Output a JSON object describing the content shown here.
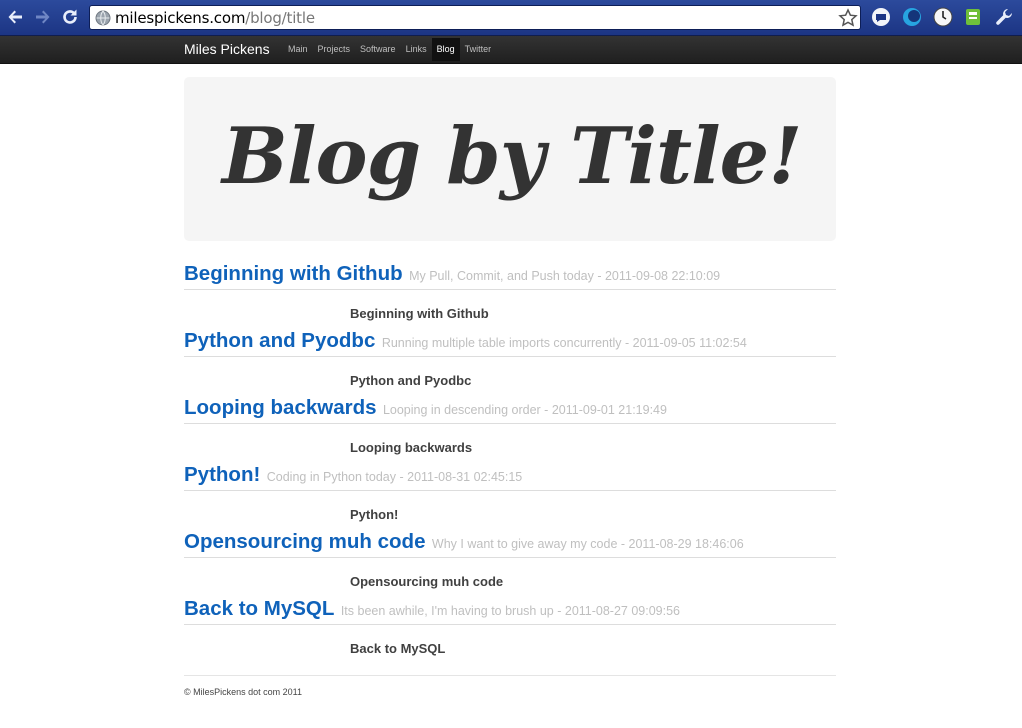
{
  "browser": {
    "url_host": "milespickens.com",
    "url_path": "/blog/title"
  },
  "site": {
    "brand": "Miles Pickens",
    "nav": [
      {
        "label": "Main"
      },
      {
        "label": "Projects"
      },
      {
        "label": "Software"
      },
      {
        "label": "Links"
      },
      {
        "label": "Blog",
        "active": true
      },
      {
        "label": "Twitter"
      }
    ]
  },
  "hero": {
    "title": "Blog by Title!"
  },
  "posts": [
    {
      "title": "Beginning with Github",
      "meta": "My Pull, Commit, and Push today - 2011-09-08 22:10:09",
      "body": "Beginning with Github"
    },
    {
      "title": "Python and Pyodbc",
      "meta": "Running multiple table imports concurrently - 2011-09-05 11:02:54",
      "body": "Python and Pyodbc"
    },
    {
      "title": "Looping backwards",
      "meta": "Looping in descending order - 2011-09-01 21:19:49",
      "body": "Looping backwards"
    },
    {
      "title": "Python!",
      "meta": "Coding in Python today - 2011-08-31 02:45:15",
      "body": "Python!"
    },
    {
      "title": "Opensourcing muh code",
      "meta": "Why I want to give away my code - 2011-08-29 18:46:06",
      "body": "Opensourcing muh code"
    },
    {
      "title": "Back to MySQL",
      "meta": "Its been awhile, I'm having to brush up - 2011-08-27 09:09:56",
      "body": "Back to MySQL"
    }
  ],
  "footer": {
    "text": "© MilesPickens dot com 2011"
  },
  "colors": {
    "link": "#0f62ba",
    "chrome": "#1c3584",
    "navbar": "#222222"
  }
}
